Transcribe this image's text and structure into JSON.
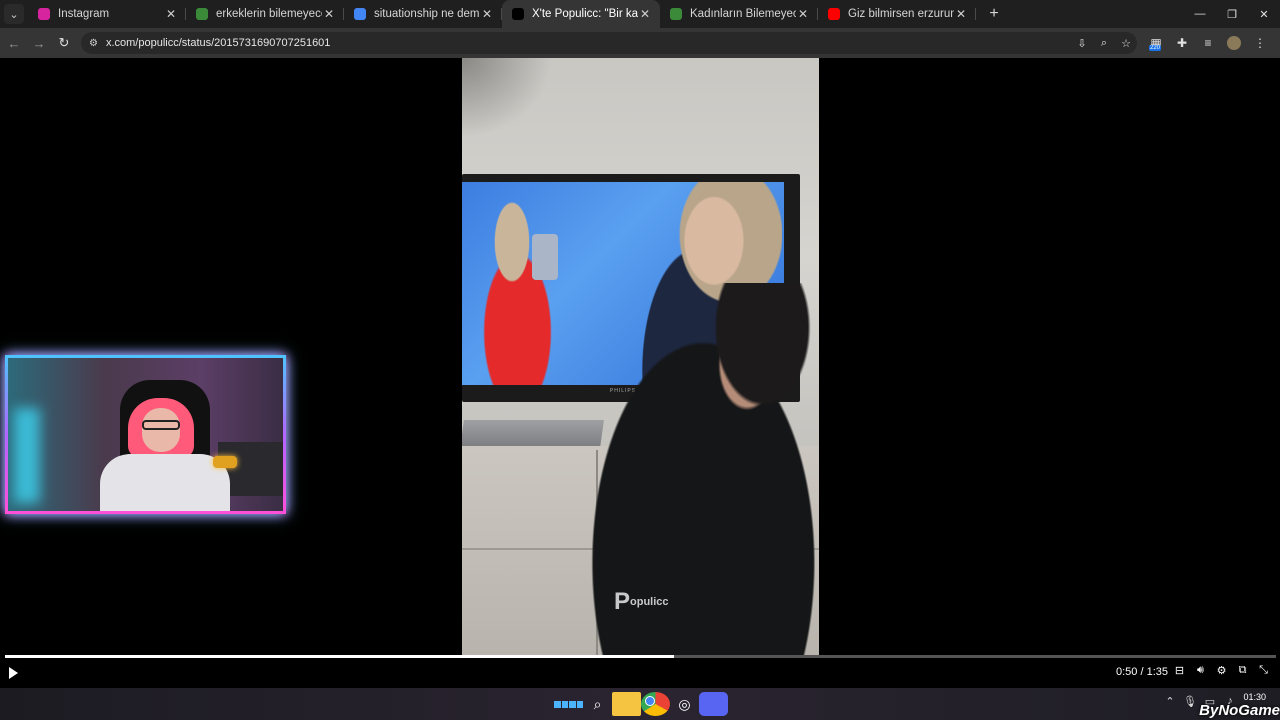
{
  "tabs": [
    {
      "title": "Instagram",
      "favicon": "instagram-icon",
      "color": "#d6249f",
      "active": false
    },
    {
      "title": "erkeklerin bilemeyeceği şeyler",
      "favicon": "image-icon",
      "color": "#3a8a3a",
      "active": false
    },
    {
      "title": "situationship ne demek - Goog",
      "favicon": "google-icon",
      "color": "#4285f4",
      "active": false
    },
    {
      "title": "X'te Populicc: \"Bir kadın, erk",
      "favicon": "x-icon",
      "color": "#000000",
      "active": true
    },
    {
      "title": "Kadınların Bilemeyeceği Şeyler",
      "favicon": "image-icon",
      "color": "#3a8a3a",
      "active": false
    },
    {
      "title": "Giz bilmirsen erzurumlu çocuk",
      "favicon": "youtube-icon",
      "color": "#ff0000",
      "active": false
    }
  ],
  "address": {
    "url": "x.com/populicc/status/2015731690707251601"
  },
  "toolbar": {
    "extension_badge": "220"
  },
  "video": {
    "watermark": "opulicc",
    "watermark_letter": "P",
    "tv_brand": "PHILIPS",
    "progress_percent": 52.6,
    "time": "0:50 / 1:35"
  },
  "taskbar": {
    "time": "01:30",
    "brand": "ByNoGame"
  }
}
